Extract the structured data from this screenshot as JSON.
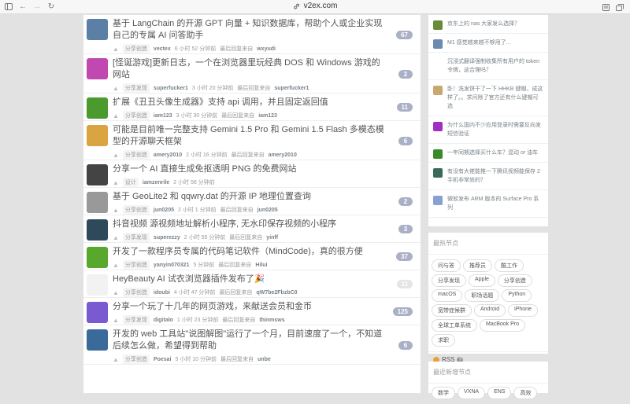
{
  "browser": {
    "url": "v2ex.com"
  },
  "topics": [
    {
      "title": "基于 LangChain 的开源 GPT 向量 + 知识数据库，帮助个人或企业实现自己的专属 AI 问答助手",
      "node": "分享创造",
      "user": "vectex",
      "time": "6 小时 52 分钟前",
      "last": "最后回复来自",
      "last_user": "wxyudi",
      "count": "67",
      "color": "#5c7fa6"
    },
    {
      "title": "[怪诞游戏]更新日志，一个在浏览器里玩经典 DOS 和 Windows 游戏的网站",
      "node": "分享发现",
      "user": "superfucker1",
      "time": "3 小时 20 分钟前",
      "last": "最后回复来自",
      "last_user": "superfucker1",
      "count": "2",
      "color": "#c048b0"
    },
    {
      "title": "扩展《丑丑头像生成器》支持 api 调用，并且固定返回值",
      "node": "分享创造",
      "user": "iam123",
      "time": "3 小时 30 分钟前",
      "last": "最后回复来自",
      "last_user": "iam123",
      "count": "11",
      "color": "#4a9a2e"
    },
    {
      "title": "可能是目前唯一完整支持 Gemini 1.5 Pro 和 Gemini 1.5 Flash 多模态模型的开源聊天框架",
      "node": "分享创造",
      "user": "amery2010",
      "time": "2 小时 16 分钟前",
      "last": "最后回复来自",
      "last_user": "amery2010",
      "count": "6",
      "color": "#d9a441"
    },
    {
      "title": "分享一个 AI 直接生成免抠透明 PNG 的免费网站",
      "node": "设计",
      "user": "iamzenrile",
      "time": "2 小时 56 分钟前",
      "last": "",
      "last_user": "",
      "count": "",
      "color": "#444444"
    },
    {
      "title": "基于 GeoLite2 和 qqwry.dat 的开源 IP 地理位置查询",
      "node": "分享创造",
      "user": "jun0205",
      "time": "2 小时 1 分钟前",
      "last": "最后回复来自",
      "last_user": "jun0205",
      "count": "2",
      "color": "#999999"
    },
    {
      "title": "抖音视频 源视频地址解析小程序, 无水印保存视频的小程序",
      "node": "分享发现",
      "user": "superezzy",
      "time": "2 小时 55 分钟前",
      "last": "最后回复来自",
      "last_user": "yinff",
      "count": "3",
      "color": "#2e4a5a"
    },
    {
      "title": "开发了一款程序员专属的代码笔记软件（MindCode)，真的很方便",
      "node": "分享创造",
      "user": "yanyin070321",
      "time": "5 分钟前",
      "last": "最后回复来自",
      "last_user": "Hilui",
      "count": "37",
      "color": "#58a82e"
    },
    {
      "title": "HeyBeauty AI 试衣浏览器插件发布了🎉",
      "node": "分享创造",
      "user": "idoubi",
      "time": "4 小时 47 分钟前",
      "last": "最后回复来自",
      "last_user": "qW7be2FbzbC0",
      "count": "11",
      "color": "#f2f2f2",
      "faint": true
    },
    {
      "title": "分享一个玩了十几年的网页游戏，来献送会员和金币",
      "node": "分享发现",
      "user": "digitalo",
      "time": "1 小时 23 分钟前",
      "last": "最后回复来自",
      "last_user": "thinmsws",
      "count": "125",
      "color": "#7a5ad0"
    },
    {
      "title": "开发的 web 工具站\"说图解图\"运行了一个月，目前速度了一个，不知道后续怎么做，希望得到帮助",
      "node": "分享创造",
      "user": "Poesai",
      "time": "5 小时 10 分钟前",
      "last": "最后回复来自",
      "last_user": "unbe",
      "count": "6",
      "color": "#3a6a9a"
    }
  ],
  "hot": [
    {
      "text": "京东上的 nas 大家发么选择？",
      "color": "#6a8a3a"
    },
    {
      "text": "M1 感觉越来越不够用了...",
      "color": "#6a8ab0"
    },
    {
      "text": "沉浸式翻译强制收集所有用户的 token 令牌，这合理吗？",
      "color": "#ffffff"
    },
    {
      "text": "卧！洗发饼干了一下 HHKB 键帽，成这样了。。求问除了官方还有什么键帽可选",
      "color": "#c8a870"
    },
    {
      "text": "为什么国内不少应用登录时需要反向发短信验证",
      "color": "#a030c0"
    },
    {
      "text": "一年同期选择买什么车？混动 or 油车",
      "color": "#3a8a2a"
    },
    {
      "text": "有没有大佬能推一下腾讯视频能保存 2 手机非常尚的？",
      "color": "#3a6a5a"
    },
    {
      "text": "微软发布 ARM 版本的 Surface Pro 系列",
      "color": "#8aa0d0"
    }
  ],
  "nodes_title": "最热节点",
  "nodes": [
    "问与答",
    "推荐员",
    "酷工作",
    "分享发现",
    "Apple",
    "分享创造",
    "macOS",
    "职场话题",
    "Python",
    "宽带症候群",
    "Android",
    "iPhone",
    "全球工单系统",
    "MacBook Pro",
    "求职"
  ],
  "rss_label": "RSS",
  "new_nodes_title": "最近新增节点",
  "new_nodes": [
    "数学",
    "VXNA",
    "ENS",
    "高效"
  ]
}
